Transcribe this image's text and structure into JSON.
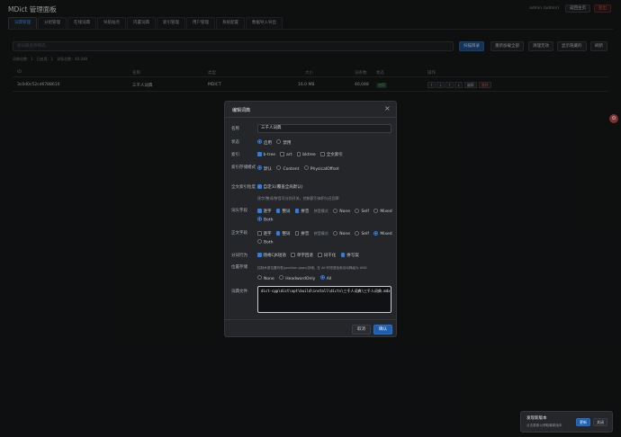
{
  "header": {
    "title": "MDict 管理面板",
    "user": "admin (admin)",
    "home_label": "返回主页",
    "logout_label": "登出"
  },
  "tabs": [
    {
      "label": "词典管理"
    },
    {
      "label": "分组管理"
    },
    {
      "label": "在线词典"
    },
    {
      "label": "导航站点"
    },
    {
      "label": "内置词典"
    },
    {
      "label": "索引管理"
    },
    {
      "label": "用户管理"
    },
    {
      "label": "系统配置"
    },
    {
      "label": "数据导入导出"
    }
  ],
  "toolbar": {
    "search_placeholder": "按词典名称筛选...",
    "scan_label": "扫描目录",
    "reload_label": "重新加载全部",
    "clear_label": "清理无效",
    "show_all_label": "显示隐藏的",
    "refresh_label": "刷新"
  },
  "stats": "词典总数：1　已启用：1　词条总数：40,048",
  "table": {
    "headers": [
      "ID",
      "名称",
      "类型",
      "大小",
      "词条数",
      "状态",
      "操作"
    ],
    "rows": [
      {
        "id": "3c0d0c52cd6788610",
        "name": "三千人词典",
        "type": "MDICT",
        "size": "16.0 MB",
        "entries": "40,048",
        "status": "启用",
        "actions": [
          "↑",
          "↓",
          "↑",
          "↓",
          "编辑",
          "删除"
        ]
      }
    ]
  },
  "modal": {
    "title": "编辑词典",
    "close_icon": "×",
    "name_label": "名称",
    "name_value": "三千人词典",
    "status_label": "状态",
    "status_options": [
      {
        "label": "启用",
        "on": true
      },
      {
        "label": "禁用",
        "on": false
      }
    ],
    "index_label": "索引",
    "index_options": [
      {
        "label": "b-tree",
        "on": true
      },
      {
        "label": "art",
        "on": false
      },
      {
        "label": "bktree",
        "on": false
      },
      {
        "label": "全文索引",
        "on": false
      }
    ],
    "storage_label": "索引存储模式",
    "storage_options": [
      {
        "label": "默认",
        "on": true
      },
      {
        "label": "Content",
        "on": false
      },
      {
        "label": "PhysicalOffset",
        "on": false
      }
    ],
    "fulltext_label": "全文索引粒度",
    "fulltext_check": "自定义(覆盖全局默认)",
    "fulltext_hint": "逐字/整词/拼音可分别开关，控制索引体积与召回率",
    "headword_label": "词头字段",
    "headword_options": [
      {
        "label": "逐字",
        "on": true
      },
      {
        "label": "整词",
        "on": true
      },
      {
        "label": "拼音",
        "on": true
      }
    ],
    "headword_pinyin_label": "拼音模式",
    "headword_modes": [
      {
        "label": "None",
        "on": false
      },
      {
        "label": "Self",
        "on": false
      },
      {
        "label": "Mixed",
        "on": false
      },
      {
        "label": "Both",
        "on": true
      }
    ],
    "body_label": "正文字段",
    "body_options": [
      {
        "label": "逐字",
        "on": false
      },
      {
        "label": "整词",
        "on": true
      },
      {
        "label": "拼音",
        "on": false
      }
    ],
    "body_pinyin_label": "拼音模式",
    "body_modes": [
      {
        "label": "None",
        "on": false
      },
      {
        "label": "Self",
        "on": false
      },
      {
        "label": "Mixed",
        "on": true
      },
      {
        "label": "Both",
        "on": false
      }
    ],
    "segment_label": "分词行为",
    "segment_options": [
      {
        "label": "随格CJK短语",
        "on": true
      },
      {
        "label": "单字回退",
        "on": false
      },
      {
        "label": "词干化",
        "on": false
      },
      {
        "label": "拼写案",
        "on": true
      }
    ],
    "position_label": "位置存储",
    "position_hint": "控制术语位置列表(position gaps)存储。在 All 时短语检索自动降级为 AND",
    "position_options": [
      {
        "label": "None",
        "on": false
      },
      {
        "label": "HeadwordOnly",
        "on": false
      },
      {
        "label": "All",
        "on": true
      }
    ],
    "file_label": "词典文件",
    "file_value": "dict-cpp\\dict\\opt\\build\\install\\dicts\\三千人词典\\三千人词典.mdx",
    "cancel_label": "取消",
    "confirm_label": "确认"
  },
  "toast": {
    "title": "发现新版本",
    "body": "点击更新以获取最新版本",
    "update_label": "更新",
    "close_label": "关闭"
  },
  "colors": {
    "background": "#161718",
    "accent": "#2f7de1",
    "danger": "#e0524c",
    "success": "#5fc27a"
  }
}
